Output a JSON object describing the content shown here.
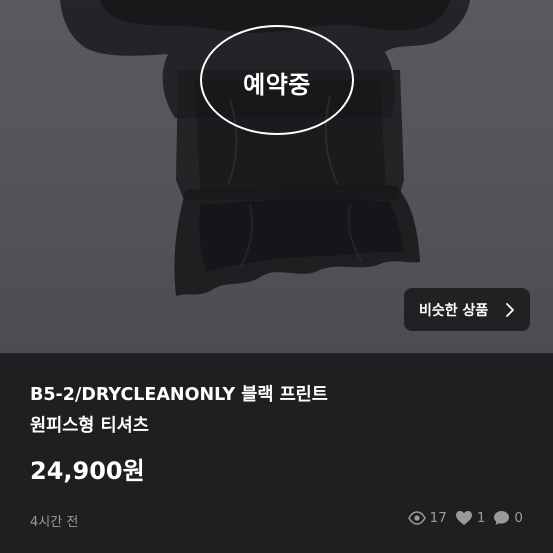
{
  "status_badge": "예약중",
  "similar_button": "비슷한 상품",
  "product": {
    "title_line1": "B5-2/DRYCLEANONLY 블랙 프린트",
    "title_line2": "원피스형 티셔츠",
    "price": "24,900원",
    "posted": "4시간 전"
  },
  "stats": {
    "views": "17",
    "likes": "1",
    "chats": "0"
  },
  "icons": {
    "views": "eye-icon",
    "likes": "heart-icon",
    "chats": "chat-bubble-icon",
    "similar": "chevron-right-icon"
  },
  "colors": {
    "background": "#1f1f21",
    "text_primary": "#ffffff",
    "text_muted": "#9a9a9d"
  }
}
